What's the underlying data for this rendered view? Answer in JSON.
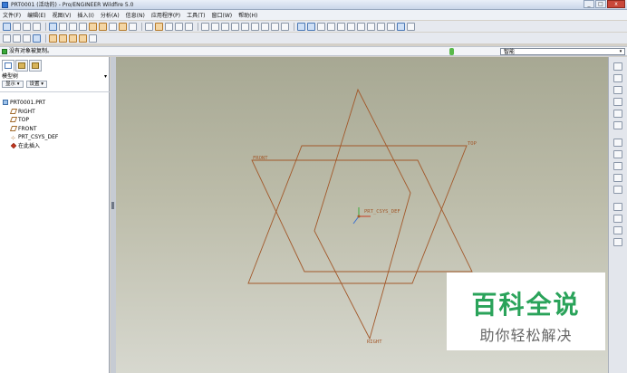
{
  "window": {
    "title": "PRT0001 (活动的) - Pro/ENGINEER Wildfire 5.0",
    "controls": [
      "_",
      "□",
      "x"
    ]
  },
  "menubar": {
    "items": [
      "文件(F)",
      "编辑(E)",
      "视图(V)",
      "插入(I)",
      "分析(A)",
      "信息(N)",
      "应用程序(P)",
      "工具(T)",
      "窗口(W)",
      "帮助(H)"
    ]
  },
  "statusbar": {
    "message": "没有对象被复制。",
    "filter_value": "智能",
    "filter_caret": "▾"
  },
  "model_tree": {
    "header": "模型树",
    "header_caret": "▾",
    "show_button": "显示 ▾",
    "settings_button": "设置 ▾",
    "nodes": [
      {
        "label": "PRT0001.PRT",
        "kind": "part",
        "child": false
      },
      {
        "label": "RIGHT",
        "kind": "plane",
        "child": true
      },
      {
        "label": "TOP",
        "kind": "plane",
        "child": true
      },
      {
        "label": "FRONT",
        "kind": "plane",
        "child": true
      },
      {
        "label": "PRT_CSYS_DEF",
        "kind": "csys",
        "child": true
      },
      {
        "label": "在此插入",
        "kind": "insert",
        "child": true
      }
    ]
  },
  "viewport": {
    "background_top": "#a7a893",
    "background_bottom": "#d7d8cf",
    "datum_color": "#a2582a",
    "labels": {
      "front": "FRONT",
      "top": "TOP",
      "right": "RIGHT",
      "csys": "PRT_CSYS_DEF"
    }
  },
  "watermark": {
    "title": "百科全说",
    "subtitle": "助你轻松解决",
    "title_color": "#2aa35a"
  }
}
